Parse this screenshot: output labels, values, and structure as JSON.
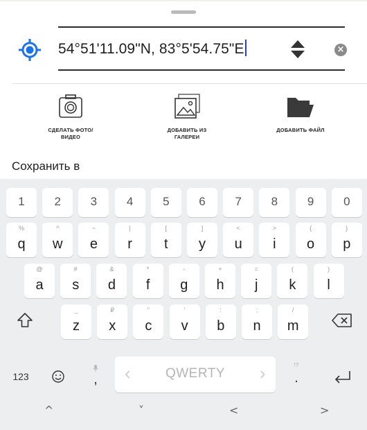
{
  "location": {
    "coordinates": "54°51'11.09\"N, 83°5'54.75\"E"
  },
  "actions": {
    "photo_label": "СДЕЛАТЬ ФОТО/\nВИДЕО",
    "gallery_label": "ДОБАВИТЬ ИЗ\nГАЛЕРЕИ",
    "file_label": "ДОБАВИТЬ ФАЙЛ"
  },
  "save_to_label": "Сохранить в",
  "colors": {
    "accent": "#1a73e8",
    "keyboard_bg": "#eceef0"
  },
  "keyboard": {
    "number_row": [
      "1",
      "2",
      "3",
      "4",
      "5",
      "6",
      "7",
      "8",
      "9",
      "0"
    ],
    "row1": [
      {
        "alt": "%",
        "key": "q"
      },
      {
        "alt": "^",
        "key": "w"
      },
      {
        "alt": "~",
        "key": "e"
      },
      {
        "alt": "|",
        "key": "r"
      },
      {
        "alt": "[",
        "key": "t"
      },
      {
        "alt": "]",
        "key": "y"
      },
      {
        "alt": "<",
        "key": "u"
      },
      {
        "alt": ">",
        "key": "i"
      },
      {
        "alt": "{",
        "key": "o"
      },
      {
        "alt": "}",
        "key": "p"
      }
    ],
    "row2": [
      {
        "alt": "@",
        "key": "a"
      },
      {
        "alt": "#",
        "key": "s"
      },
      {
        "alt": "&",
        "key": "d"
      },
      {
        "alt": "*",
        "key": "f"
      },
      {
        "alt": "-",
        "key": "g"
      },
      {
        "alt": "+",
        "key": "h"
      },
      {
        "alt": "=",
        "key": "j"
      },
      {
        "alt": "(",
        "key": "k"
      },
      {
        "alt": ")",
        "key": "l"
      }
    ],
    "row3": [
      {
        "alt": "_",
        "key": "z"
      },
      {
        "alt": "₽",
        "key": "x"
      },
      {
        "alt": "\"",
        "key": "c"
      },
      {
        "alt": "'",
        "key": "v"
      },
      {
        "alt": ":",
        "key": "b"
      },
      {
        "alt": ";",
        "key": "n"
      },
      {
        "alt": "/",
        "key": "m"
      }
    ],
    "symbols_label": "123",
    "comma_key": ",",
    "period_key": ".",
    "period_alt": "!?",
    "space_label": "QWERTY",
    "shift_icon": "shift-icon",
    "backspace_icon": "backspace-icon",
    "enter_icon": "enter-icon",
    "emoji_icon": "emoji-icon",
    "mic_icon": "mic-icon"
  },
  "navbar": {
    "up": "^",
    "down": "˅",
    "left": "<",
    "right": ">"
  }
}
